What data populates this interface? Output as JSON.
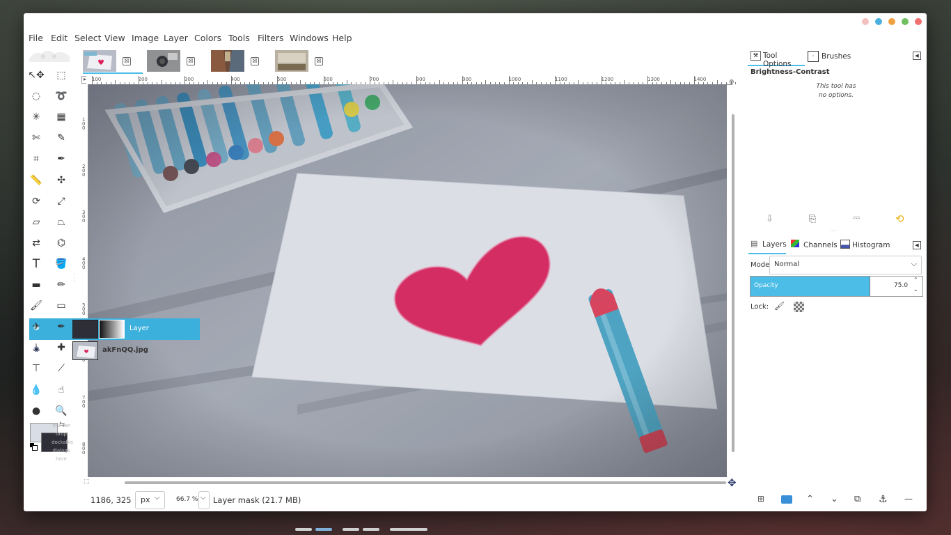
{
  "menubar": [
    "File",
    "Edit",
    "Select",
    "View",
    "Image",
    "Layer",
    "Colors",
    "Tools",
    "Filters",
    "Windows",
    "Help"
  ],
  "window_buttons": [
    "#f4c0c0",
    "#4ab0e0",
    "#f0a040",
    "#70c060",
    "#f07070"
  ],
  "image_tabs": [
    {
      "name": "heart-thumb",
      "close": "☒"
    },
    {
      "name": "camera-thumb",
      "close": "☒"
    },
    {
      "name": "street-thumb",
      "close": "☒"
    },
    {
      "name": "room-thumb",
      "close": "☒"
    }
  ],
  "ruler": {
    "h_labels": [
      "100",
      "200",
      "300",
      "400",
      "500",
      "600",
      "700",
      "800",
      "900",
      "1000",
      "1100",
      "1200",
      "1300",
      "1400"
    ],
    "v_labels": [
      "1 0 0",
      "2 0 0",
      "3 0 0",
      "4 0 0",
      "5 0 0",
      "6 0 0",
      "7 0 0",
      "8 0 0"
    ]
  },
  "toolbox_hint": "You can drop dockable dialogs here",
  "status": {
    "coords": "1186, 325",
    "unit": "px",
    "zoom": "66.7 %",
    "info": "Layer mask (21.7 MB)"
  },
  "tool_options": {
    "tab_label": "Tool Options",
    "brushes_label": "Brushes",
    "tool_name": "Brightness-Contrast",
    "message": "This tool has no options."
  },
  "layers_panel": {
    "tabs": [
      "Layers",
      "Channels",
      "Histogram"
    ],
    "mode_label": "Mode:",
    "mode_value": "Normal",
    "opacity_label": "Opacity",
    "opacity_value": "75.0",
    "opacity_fraction": 0.75,
    "lock_label": "Lock:",
    "layers": [
      {
        "name": "Layer",
        "selected": true
      },
      {
        "name": "akFnQQ.jpg",
        "selected": false
      }
    ]
  },
  "colors": {
    "accent": "#4bbde6",
    "fg_color": "#2d2e38",
    "bg_color": "#d8dde6"
  }
}
